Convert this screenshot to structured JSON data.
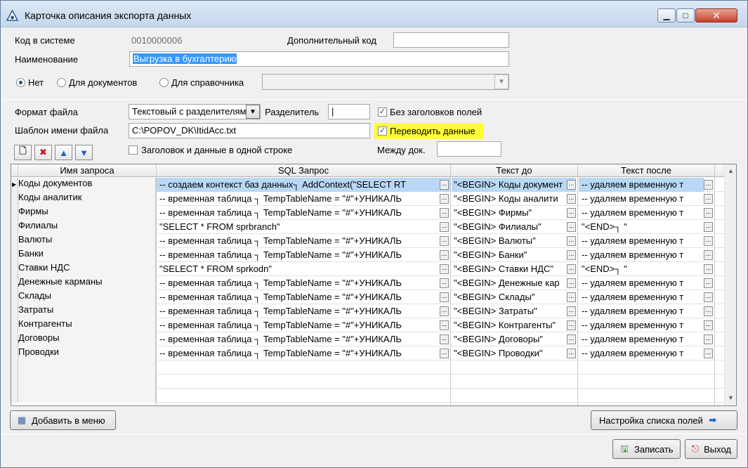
{
  "window": {
    "title": "Карточка описания экспорта данных"
  },
  "form": {
    "code_label": "Код в системе",
    "code_value": "0010000006",
    "extra_code_label": "Дополнительный код",
    "extra_code_value": "",
    "name_label": "Наименование",
    "name_value": "Выгрузка  в бухгалтерию",
    "radio_none": "Нет",
    "radio_docs": "Для документов",
    "radio_ref": "Для справочника",
    "ref_value": "",
    "file_format_label": "Формат файла",
    "file_format_value": "Текстовый с разделителям",
    "separator_label": "Разделитель",
    "separator_value": "|",
    "no_headers_label": "Без заголовков полей",
    "template_label": "Шаблон имени файла",
    "template_value": "C:\\POPOV_DK\\ItidAcc.txt",
    "translate_label": "Переводить данные",
    "same_line_label": "Заголовок и данные в одной строке",
    "between_docs_label": "Между док.",
    "between_docs_value": ""
  },
  "grid": {
    "headers": [
      "Имя запроса",
      "SQL Запрос",
      "Текст до",
      "Текст после"
    ],
    "rows": [
      {
        "name": "Коды документов",
        "sql": "-- создаем контекст баз данных┐   AddContext(\"SELECT RT",
        "before": "\"<BEGIN> Коды документ",
        "after": "-- удаляем временную т"
      },
      {
        "name": "Коды аналитик",
        "sql": "-- временная таблица ┐    TempTableName = \"#\"+УНИКАЛЬ",
        "before": "\"<BEGIN> Коды аналити",
        "after": "-- удаляем временную т"
      },
      {
        "name": "Фирмы",
        "sql": "-- временная таблица ┐    TempTableName = \"#\"+УНИКАЛЬ",
        "before": "\"<BEGIN> Фирмы\"",
        "after": "-- удаляем временную т"
      },
      {
        "name": "Филиалы",
        "sql": "\"SELECT * FROM sprbranch\"",
        "before": "\"<BEGIN> Филиалы\"",
        "after": "\"<END>┐    \""
      },
      {
        "name": "Валюты",
        "sql": "-- временная таблица ┐    TempTableName = \"#\"+УНИКАЛЬ",
        "before": "\"<BEGIN> Валюты\"",
        "after": "-- удаляем временную т"
      },
      {
        "name": "Банки",
        "sql": "-- временная таблица ┐    TempTableName = \"#\"+УНИКАЛЬ",
        "before": "\"<BEGIN> Банки\"",
        "after": "-- удаляем временную т"
      },
      {
        "name": "Ставки НДС",
        "sql": "\"SELECT * FROM sprkodn\"",
        "before": "\"<BEGIN> Ставки НДС\"",
        "after": "\"<END>┐    \""
      },
      {
        "name": "Денежные карманы",
        "sql": "-- временная таблица ┐    TempTableName = \"#\"+УНИКАЛЬ",
        "before": "\"<BEGIN> Денежные кар",
        "after": "-- удаляем временную т"
      },
      {
        "name": "Склады",
        "sql": "-- временная таблица ┐    TempTableName = \"#\"+УНИКАЛЬ",
        "before": "\"<BEGIN> Склады\"",
        "after": "-- удаляем временную т"
      },
      {
        "name": "Затраты",
        "sql": "-- временная таблица ┐    TempTableName = \"#\"+УНИКАЛЬ",
        "before": "\"<BEGIN> Затраты\"",
        "after": "-- удаляем временную т"
      },
      {
        "name": "Контрагенты",
        "sql": "-- временная таблица ┐    TempTableName = \"#\"+УНИКАЛЬ",
        "before": "\"<BEGIN> Контрагенты\"",
        "after": "-- удаляем временную т"
      },
      {
        "name": "Договоры",
        "sql": "-- временная таблица ┐    TempTableName = \"#\"+УНИКАЛЬ",
        "before": "\"<BEGIN> Договоры\"",
        "after": "-- удаляем временную т"
      },
      {
        "name": "Проводки",
        "sql": "-- временная таблица ┐    TempTableName = \"#\"+УНИКАЛЬ",
        "before": "\"<BEGIN> Проводки\"",
        "after": "-- удаляем временную т"
      }
    ],
    "ellipsis": "..."
  },
  "buttons": {
    "add_menu": "Добавить в меню",
    "fields_setup": "Настройка списка полей",
    "save": "Записать",
    "exit": "Выход"
  }
}
